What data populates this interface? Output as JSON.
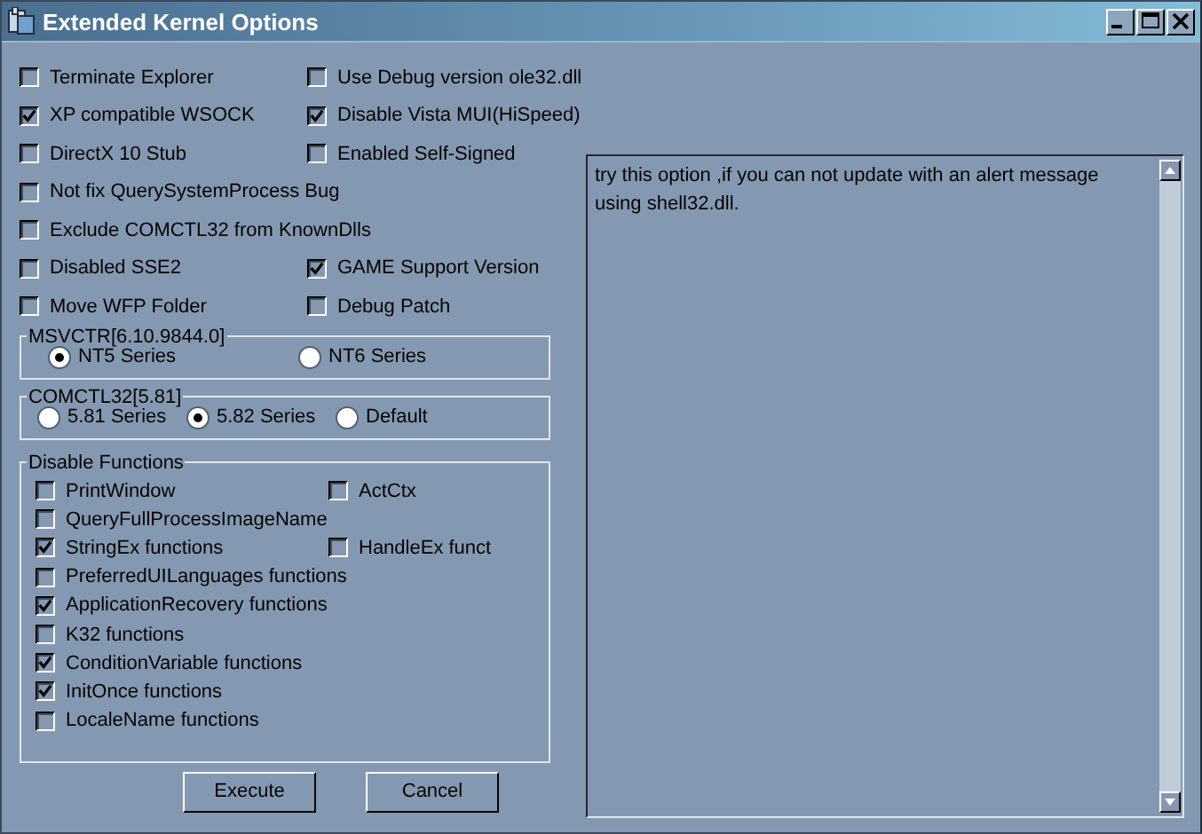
{
  "window": {
    "title": "Extended Kernel Options"
  },
  "options": [
    [
      {
        "label": "Terminate Explorer",
        "checked": false
      },
      {
        "label": "Use Debug version ole32.dll",
        "checked": false
      }
    ],
    [
      {
        "label": "XP compatible WSOCK",
        "checked": true
      },
      {
        "label": "Disable Vista MUI(HiSpeed)",
        "checked": true
      }
    ],
    [
      {
        "label": "DirectX 10 Stub",
        "checked": false
      },
      {
        "label": "Enabled Self-Signed",
        "checked": false
      }
    ],
    [
      {
        "label": "Not fix QuerySystemProcess Bug",
        "checked": false
      }
    ],
    [
      {
        "label": "Exclude COMCTL32 from KnownDlls",
        "checked": false
      }
    ],
    [
      {
        "label": "Disabled SSE2",
        "checked": false
      },
      {
        "label": "GAME Support Version",
        "checked": true
      }
    ],
    [
      {
        "label": "Move WFP Folder",
        "checked": false
      },
      {
        "label": "Debug Patch",
        "checked": false
      }
    ]
  ],
  "radio_groups": [
    {
      "title": "MSVCTR[6.10.9844.0]",
      "options": [
        {
          "label": "NT5 Series",
          "selected": true
        },
        {
          "label": "NT6 Series",
          "selected": false
        }
      ]
    },
    {
      "title": "COMCTL32[5.81]",
      "options": [
        {
          "label": "5.81 Series",
          "selected": false
        },
        {
          "label": "5.82 Series",
          "selected": true
        },
        {
          "label": "Default",
          "selected": false
        }
      ]
    }
  ],
  "disable_functions": {
    "title": "Disable Functions",
    "rows": [
      [
        {
          "label": "PrintWindow",
          "checked": false
        },
        {
          "label": "ActCtx",
          "checked": false
        }
      ],
      [
        {
          "label": "QueryFullProcessImageName",
          "checked": false
        }
      ],
      [
        {
          "label": "StringEx functions",
          "checked": true
        },
        {
          "label": "HandleEx funct",
          "checked": false
        }
      ],
      [
        {
          "label": "PreferredUILanguages functions",
          "checked": false
        }
      ],
      [
        {
          "label": "ApplicationRecovery functions",
          "checked": true
        }
      ],
      [
        {
          "label": "K32 functions",
          "checked": false
        }
      ],
      [
        {
          "label": "ConditionVariable functions",
          "checked": true
        }
      ],
      [
        {
          "label": "InitOnce functions",
          "checked": true
        }
      ],
      [
        {
          "label": "LocaleName functions",
          "checked": false
        }
      ]
    ]
  },
  "buttons": [
    "Execute",
    "Cancel"
  ],
  "description": "try this option ,if you can not update with an alert message using shell32.dll."
}
